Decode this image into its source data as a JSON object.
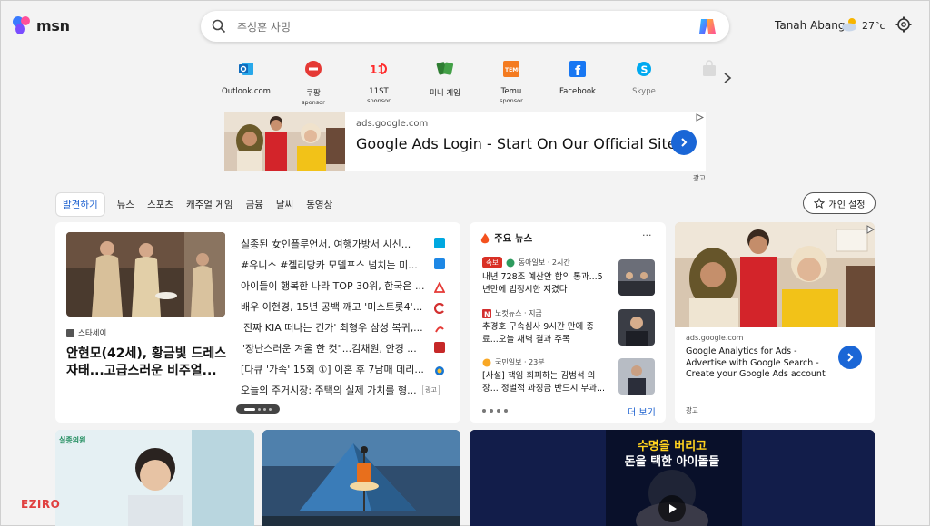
{
  "header": {
    "logo_text": "msn",
    "search_placeholder": "추성훈 사밍",
    "location": "Tanah Abang",
    "temperature": "27°c"
  },
  "quick_links": [
    {
      "label": "Outlook.com",
      "sponsor": "",
      "icon": "outlook-icon",
      "color": "#0f6cbd"
    },
    {
      "label": "쿠팡",
      "sponsor": "sponsor",
      "icon": "coupang-icon",
      "color": "#e53935"
    },
    {
      "label": "11ST",
      "sponsor": "sponsor",
      "icon": "11st-icon",
      "color": "#ff2a2a"
    },
    {
      "label": "미니 게임",
      "sponsor": "",
      "icon": "cards-game-icon",
      "color": "#2e7d32"
    },
    {
      "label": "Temu",
      "sponsor": "sponsor",
      "icon": "temu-icon",
      "color": "#f47b20"
    },
    {
      "label": "Facebook",
      "sponsor": "",
      "icon": "facebook-icon",
      "color": "#1877f2"
    },
    {
      "label": "Skype",
      "sponsor": "",
      "icon": "skype-icon",
      "color": "#00a9f0"
    }
  ],
  "top_ad": {
    "url": "ads.google.com",
    "title": "Google Ads Login - Start On Our Official Site",
    "ad_label": "광고"
  },
  "tabs": [
    "발견하기",
    "뉴스",
    "스포츠",
    "캐주얼 게임",
    "금융",
    "날씨",
    "동영상"
  ],
  "personalize_label": "개인 설정",
  "main_news": {
    "lead_source": "스타세이",
    "lead_title": "안현모(42세), 황금빛 드레스 자태...고급스러운 비주얼...",
    "headlines": [
      {
        "text": "실종된 女인플루언서, 여행가방서 시신...",
        "icon_color": "#00a8e0"
      },
      {
        "text": "#유니스 #젤리당카 모델포스 넘치는 미...",
        "icon_color": "#1e88e5"
      },
      {
        "text": "아이들이 행복한 나라 TOP 30위, 한국은 ...",
        "icon_color": "#e53935"
      },
      {
        "text": "배우 이현경, 15년 공백 깨고 '미스트롯4'...",
        "icon_color": "#d32f2f"
      },
      {
        "text": "'진짜 KIA 떠나는 건가' 최형우 삼성 복귀,...",
        "icon_color": "#e53935"
      },
      {
        "text": "\"장난스러운 겨울 한 컷\"...김채원, 안경 ...",
        "icon_color": "#c62828"
      },
      {
        "text": "[다큐 '가족' 15회 ①] 이혼 후 7남매 데리...",
        "icon_color": "#1976d2"
      },
      {
        "text": "오늘의 주거시장: 주택의 실제 가치를 형...",
        "icon_color": "#9e9e9e",
        "tag": "광고"
      }
    ]
  },
  "top_stories": {
    "heading": "주요 뉴스",
    "items": [
      {
        "badge": "속보",
        "source": "동아일보 · 2시간",
        "title": "내년 728조 예산안 합의 통과...5년만에 법정시한 지켰다"
      },
      {
        "badge": "",
        "source": "노컷뉴스 · 지금",
        "title": "추경호 구속심사 9시간 만에 종료...오늘 새벽 결과 주목"
      },
      {
        "badge": "",
        "source": "국민일보 · 23분",
        "title": "[사설] 책임 회피하는 김범석 의장... 정벌적 과징금 반드시 부과..."
      }
    ],
    "see_more": "더 보기"
  },
  "right_ad": {
    "url": "ads.google.com",
    "title": "Google Analytics for Ads - Advertise with Google Search - Create your Google Ads account",
    "ad_label": "광고"
  },
  "bottom": {
    "video_title_line1": "수명을 버리고",
    "video_title_line2": "돈을 택한 아이돌들",
    "thumb1_tag": "실종의원",
    "watermark": "EZIRO"
  }
}
